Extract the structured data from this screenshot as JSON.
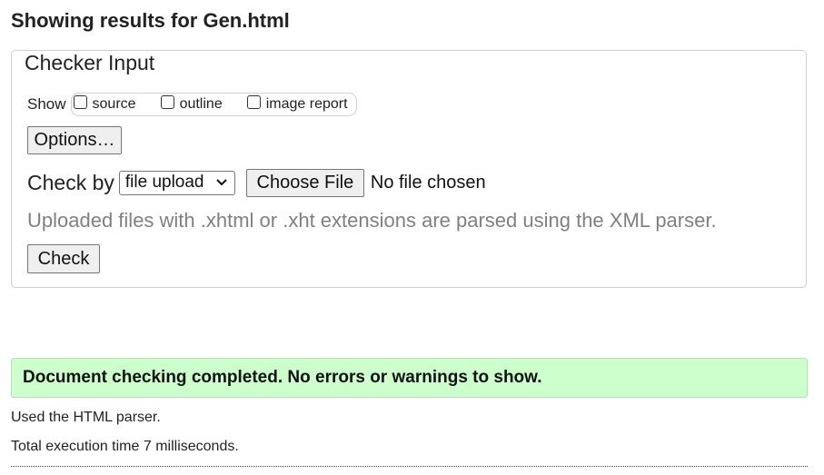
{
  "header": {
    "title": "Showing results for Gen.html"
  },
  "checker": {
    "legend": "Checker Input",
    "show_label": "Show",
    "show_options": [
      {
        "label": "source",
        "checked": false
      },
      {
        "label": "outline",
        "checked": false
      },
      {
        "label": "image report",
        "checked": false
      }
    ],
    "options_button": "Options…",
    "check_by_label": "Check by",
    "check_by_selected": "file upload",
    "choose_file_button": "Choose File",
    "file_status": "No file chosen",
    "upload_note": "Uploaded files with .xhtml or .xht extensions are parsed using the XML parser.",
    "check_button": "Check"
  },
  "results": {
    "success_message": "Document checking completed. No errors or warnings to show.",
    "success_color": "#ccffcc",
    "parser_info": "Used the HTML parser.",
    "execution_time": "Total execution time 7 milliseconds."
  }
}
